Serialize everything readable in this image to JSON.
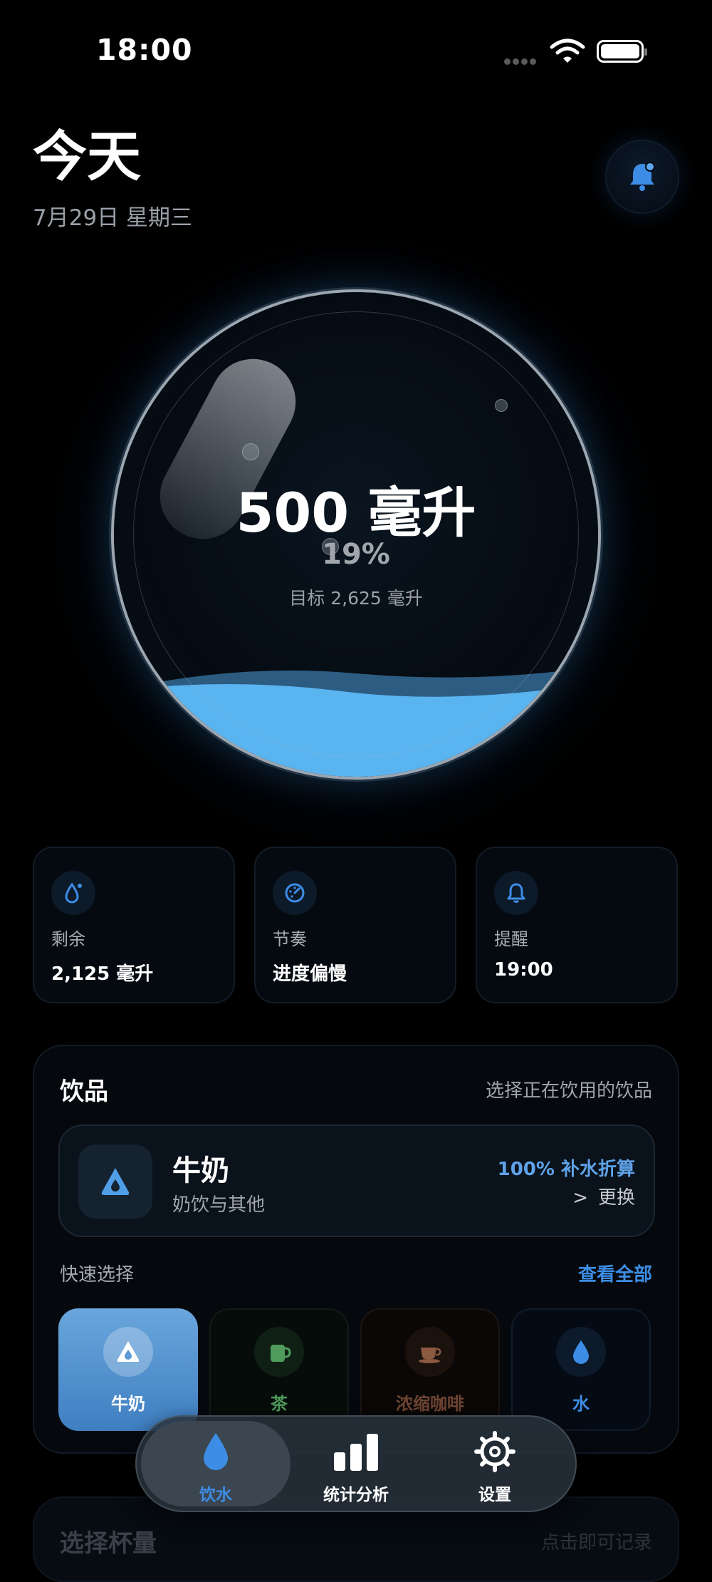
{
  "status_bar": {
    "time": "18:00"
  },
  "header": {
    "title": "今天",
    "date": "7月29日 星期三"
  },
  "glass": {
    "amount": "500 毫升",
    "percent_text": "19%",
    "goal_text": "目标 2,625 毫升",
    "fill_fraction": 0.19
  },
  "stats": [
    {
      "label": "剩余",
      "value": "2,125 毫升",
      "icon": "drop-icon"
    },
    {
      "label": "节奏",
      "value": "进度偏慢",
      "icon": "gauge-icon"
    },
    {
      "label": "提醒",
      "value": "19:00",
      "icon": "bell-icon"
    }
  ],
  "drinks": {
    "title": "饮品",
    "hint": "选择正在饮用的饮品",
    "selected": {
      "name": "牛奶",
      "category": "奶饮与其他",
      "ratio": "100% 补水折算",
      "change_label": "更换"
    },
    "quick_title": "快速选择",
    "view_all": "查看全部",
    "quick": [
      {
        "label": "牛奶",
        "color": "#ffffff"
      },
      {
        "label": "茶",
        "color": "#4f9c5c"
      },
      {
        "label": "浓缩咖啡",
        "color": "#7a4a34"
      },
      {
        "label": "水",
        "color": "#3d8de6"
      }
    ]
  },
  "cup_section": {
    "title": "选择杯量",
    "hint": "点击即可记录"
  },
  "tabbar": {
    "tabs": [
      {
        "label": "饮水"
      },
      {
        "label": "统计分析"
      },
      {
        "label": "设置"
      }
    ]
  },
  "colors": {
    "accent": "#3d8de6",
    "water": "#5ab4f0",
    "background": "#000000"
  }
}
